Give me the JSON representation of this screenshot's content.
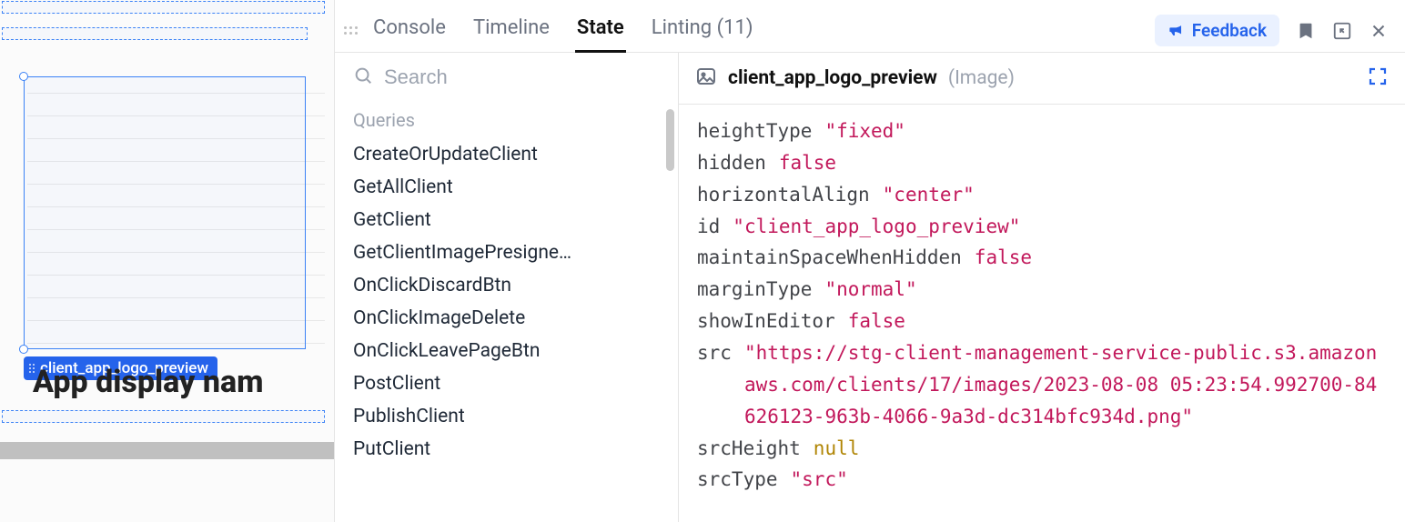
{
  "canvas": {
    "selected_component_label": "client_app_logo_preview",
    "display_text": "App display nam"
  },
  "tabs": {
    "console": "Console",
    "timeline": "Timeline",
    "state": "State",
    "linting": "Linting (11)",
    "active": "state"
  },
  "toolbar": {
    "feedback_label": "Feedback"
  },
  "sidebar": {
    "search_placeholder": "Search",
    "section_label": "Queries",
    "queries": [
      "CreateOrUpdateClient",
      "GetAllClient",
      "GetClient",
      "GetClientImagePresigne…",
      "OnClickDiscardBtn",
      "OnClickImageDelete",
      "OnClickLeavePageBtn",
      "PostClient",
      "PublishClient",
      "PutClient"
    ]
  },
  "properties": {
    "header": {
      "name": "client_app_logo_preview",
      "type_label": "(Image)"
    },
    "rows": [
      {
        "key": "heightType",
        "value": "\"fixed\"",
        "type": "string"
      },
      {
        "key": "hidden",
        "value": "false",
        "type": "bool"
      },
      {
        "key": "horizontalAlign",
        "value": "\"center\"",
        "type": "string"
      },
      {
        "key": "id",
        "value": "\"client_app_logo_preview\"",
        "type": "string"
      },
      {
        "key": "maintainSpaceWhenHidden",
        "value": "false",
        "type": "bool"
      },
      {
        "key": "marginType",
        "value": "\"normal\"",
        "type": "string"
      },
      {
        "key": "showInEditor",
        "value": "false",
        "type": "bool"
      },
      {
        "key": "src",
        "value": "\"https://stg-client-management-service-public.s3.amazonaws.com/clients/17/images/2023-08-08 05:23:54.992700-84626123-963b-4066-9a3d-dc314bfc934d.png\"",
        "type": "string",
        "multiline": true
      },
      {
        "key": "srcHeight",
        "value": "null",
        "type": "null"
      },
      {
        "key": "srcType",
        "value": "\"src\"",
        "type": "string"
      }
    ]
  }
}
